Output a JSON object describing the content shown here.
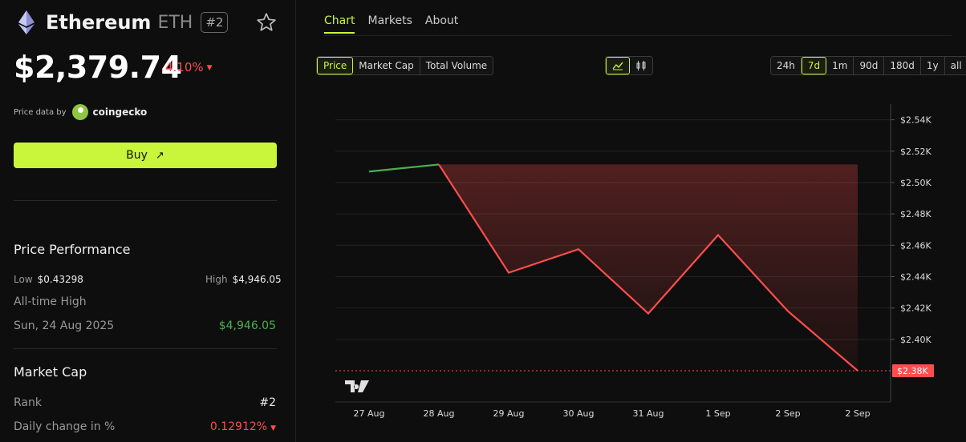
{
  "coin": {
    "name": "Ethereum",
    "symbol": "ETH",
    "rank_badge": "#2",
    "price": "$2,379.74",
    "change_pct": "4.10%",
    "price_data_label": "Price data by",
    "provider": "coingecko",
    "buy_label": "Buy"
  },
  "performance": {
    "title": "Price Performance",
    "low_label": "Low",
    "low_value": "$0.43298",
    "high_label": "High",
    "high_value": "$4,946.05",
    "ath_label": "All-time High",
    "ath_date": "Sun, 24 Aug 2025",
    "ath_value": "$4,946.05"
  },
  "market_cap": {
    "title": "Market Cap",
    "rank_label": "Rank",
    "rank_value": "#2",
    "daily_change_label": "Daily change in %",
    "daily_change_value": "0.12912%"
  },
  "colors": {
    "accent": "#c9f53a",
    "down": "#ff4d4d",
    "up": "#4caf50"
  },
  "tabs": [
    "Chart",
    "Markets",
    "About"
  ],
  "metric_buttons": [
    "Price",
    "Market Cap",
    "Total Volume"
  ],
  "chart_type_icons": [
    "line-chart-icon",
    "candlestick-icon"
  ],
  "range_buttons": [
    "24h",
    "7d",
    "1m",
    "90d",
    "180d",
    "1y",
    "all"
  ],
  "chart_data": {
    "type": "line",
    "x": [
      "27 Aug",
      "28 Aug",
      "29 Aug",
      "30 Aug",
      "31 Aug",
      "1 Sep",
      "2 Sep",
      "2 Sep"
    ],
    "y_ticks": [
      "$2.54K",
      "$2.52K",
      "$2.50K",
      "$2.48K",
      "$2.46K",
      "$2.44K",
      "$2.42K",
      "$2.40K"
    ],
    "ylim": [
      2380,
      2550
    ],
    "current_label": "$2.38K",
    "series": [
      {
        "points": [
          [
            0,
            2507
          ],
          [
            1,
            2511.5
          ],
          [
            2,
            2442.5
          ],
          [
            3,
            2457.5
          ],
          [
            4,
            2416.5
          ],
          [
            5,
            2466.5
          ],
          [
            6,
            2418
          ],
          [
            7,
            2380
          ]
        ]
      }
    ]
  }
}
